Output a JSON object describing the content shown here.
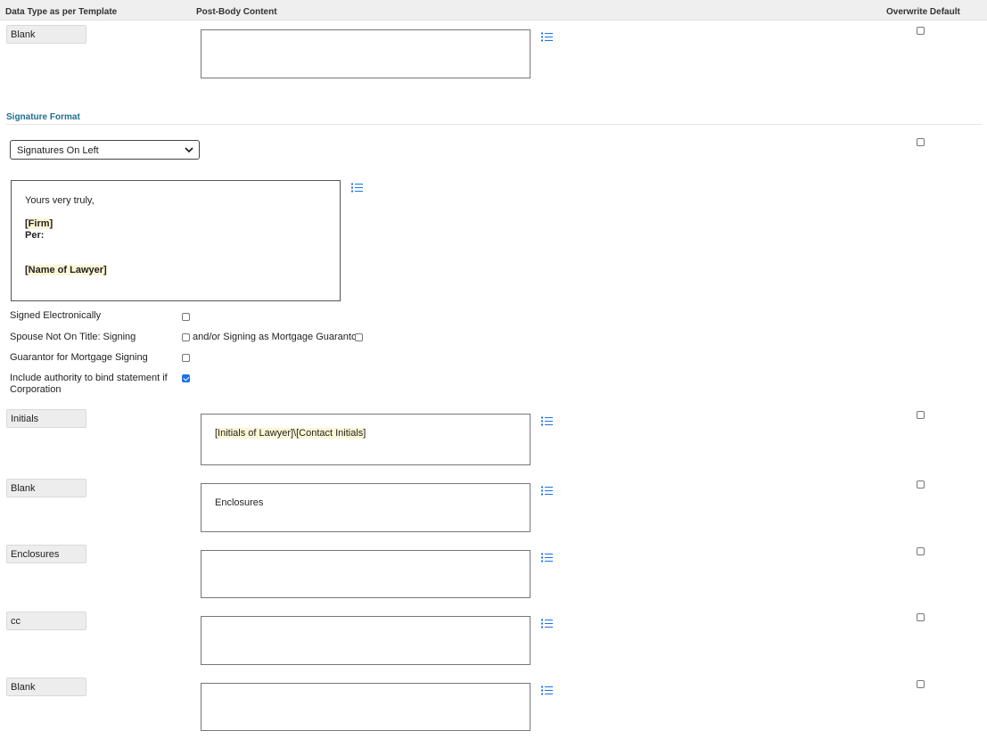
{
  "header": {
    "col_type": "Data Type as per Template",
    "col_content": "Post-Body Content",
    "col_overwrite": "Overwrite Default"
  },
  "rows_top": [
    {
      "type": "Blank",
      "content": ""
    }
  ],
  "signature": {
    "section_title": "Signature Format",
    "format_selected": "Signatures On Left",
    "text": {
      "closing": "Yours very truly,",
      "firm": "[Firm]",
      "per": "Per:",
      "lawyer": "[Name of Lawyer]"
    },
    "options": {
      "signed_electronically": {
        "label": "Signed Electronically",
        "checked": false
      },
      "spouse_not_on_title": {
        "label": "Spouse Not On Title: Signing",
        "checked": false
      },
      "mortgage_guarantor": {
        "label": "and/or Signing as Mortgage Guarantor",
        "checked": false
      },
      "guarantor_mortgage": {
        "label": "Guarantor for Mortgage Signing",
        "checked": false
      },
      "include_authority": {
        "label": "Include authority to bind statement if Corporation",
        "checked": true
      }
    }
  },
  "rows_bottom": [
    {
      "type": "Initials",
      "content": "[Initials of Lawyer]\\[Contact Initials]"
    },
    {
      "type": "Blank",
      "content": "Enclosures"
    },
    {
      "type": "Enclosures",
      "content": ""
    },
    {
      "type": "cc",
      "content": ""
    },
    {
      "type": "Blank",
      "content": ""
    }
  ],
  "icons": {
    "list": "list-bullets-icon",
    "checkbox": "checkbox-icon",
    "dropdown": "chevron-down-icon"
  },
  "colors": {
    "accent": "#1f6e8c",
    "icon_blue": "#1a73e8",
    "tag_highlight": "#fdf6d6"
  }
}
